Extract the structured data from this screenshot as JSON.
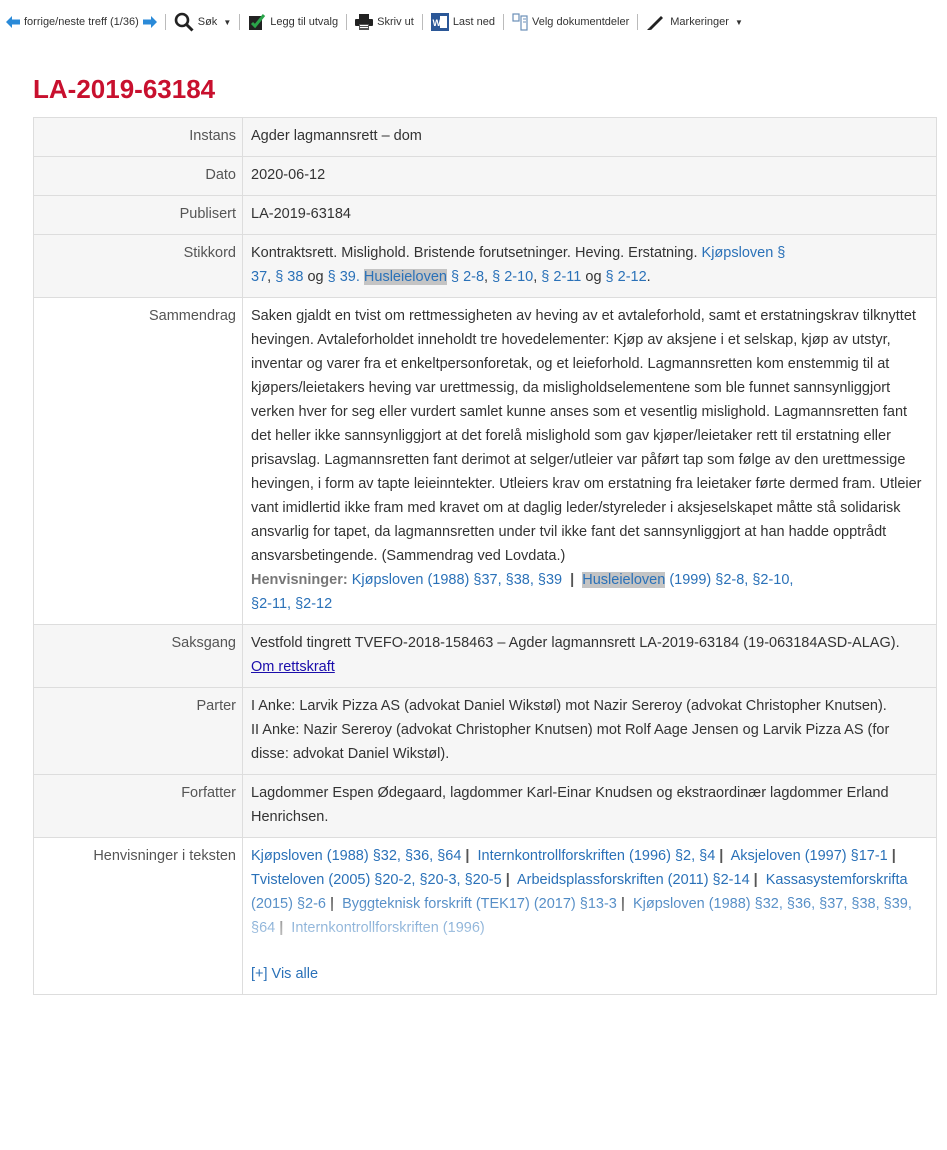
{
  "toolbar": {
    "nav_label": "forrige/neste treff (1/36)",
    "search_label": "Søk",
    "add_label": "Legg til utvalg",
    "print_label": "Skriv ut",
    "download_label": "Last ned",
    "select_parts_label": "Velg dokumentdeler",
    "markings_label": "Markeringer"
  },
  "document": {
    "title": "LA-2019-63184",
    "instans": {
      "label": "Instans",
      "value": "Agder lagmannsrett – dom"
    },
    "dato": {
      "label": "Dato",
      "value": "2020-06-12"
    },
    "publisert": {
      "label": "Publisert",
      "value": "LA-2019-63184"
    },
    "stikkord": {
      "label": "Stikkord",
      "text": "Kontraktsrett. Mislighold. Bristende forutsetninger. Heving. Erstatning.",
      "link_kjopsloven": "Kjøpsloven §",
      "link_37": "37",
      "link_38": "§ 38",
      "og": "og",
      "link_39": "§ 39.",
      "link_husleieloven": "Husleieloven",
      "link_2_8": "§ 2-8",
      "link_2_10": "§ 2-10",
      "link_2_11": "§ 2-11",
      "og2": "og",
      "link_2_12": "§ 2-12"
    },
    "sammendrag": {
      "label": "Sammendrag",
      "text": "Saken gjaldt en tvist om rettmessigheten av heving av et avtaleforhold, samt et erstatningskrav tilknyttet hevingen. Avtaleforholdet inneholdt tre hovedelementer: Kjøp av aksjene i et selskap, kjøp av utstyr, inventar og varer fra et enkeltpersonforetak, og et leieforhold. Lagmannsretten kom enstemmig til at kjøpers/leietakers heving var urettmessig, da misligholdselementene som ble funnet sannsynliggjort verken hver for seg eller vurdert samlet kunne anses som et vesentlig mislighold. Lagmannsretten fant det heller ikke sannsynliggjort at det forelå mislighold som gav kjøper/leietaker rett til erstatning eller prisavslag. Lagmannsretten fant derimot at selger/utleier var påført tap som følge av den urettmessige hevingen, i form av tapte leieinntekter. Utleiers krav om erstatning fra leietaker førte dermed fram. Utleier vant imidlertid ikke fram med kravet om at daglig leder/styreleder i aksjeselskapet måtte stå solidarisk ansvarlig for tapet, da lagmannsretten under tvil ikke fant det sannsynliggjort at han hadde opptrådt ansvarsbetingende. (Sammendrag ved Lovdata.)",
      "henvisninger_label": "Henvisninger:",
      "ref1": "Kjøpsloven (1988) §37, §38, §39",
      "ref2_hl": "Husleieloven",
      "ref2_rest": "(1999) §2-8, §2-10,",
      "ref2_tail": "§2-11, §2-12"
    },
    "saksgang": {
      "label": "Saksgang",
      "value": "Vestfold tingrett TVEFO-2018-158463 – Agder lagmannsrett LA-2019-63184 (19-063184ASD-ALAG).",
      "link": "Om rettskraft"
    },
    "parter": {
      "label": "Parter",
      "line1": "I Anke: Larvik Pizza AS (advokat Daniel Wikstøl) mot Nazir Sereroy (advokat Christopher Knutsen).",
      "line2": "II Anke: Nazir Sereroy (advokat Christopher Knutsen) mot Rolf Aage Jensen og Larvik Pizza AS (for disse: advokat Daniel Wikstøl)."
    },
    "forfatter": {
      "label": "Forfatter",
      "value": "Lagdommer Espen Ødegaard, lagdommer Karl-Einar Knudsen og ekstraordinær lagdommer Erland Henrichsen."
    },
    "henvisninger_tekst": {
      "label": "Henvisninger i teksten",
      "refs": [
        "Kjøpsloven (1988) §32, §36, §64",
        "Internkontrollforskriften (1996) §2, §4",
        "Aksjeloven (1997) §17-1",
        "Tvisteloven (2005) §20-2, §20-3, §20-5",
        "Arbeidsplassforskriften (2011) §2-14",
        "Kassasystemforskrifta (2015) §2-6",
        "Byggteknisk forskrift (TEK17) (2017) §13-3",
        "Kjøpsloven (1988) §32, §36, §37, §38, §39, §64",
        "Internkontrollforskriften (1996)"
      ],
      "show_all": "[+] Vis alle"
    }
  },
  "colors": {
    "title": "#c8102e",
    "link": "#2a71b8",
    "highlight": "#c4c4c4",
    "row_alt": "#f6f6f6"
  }
}
